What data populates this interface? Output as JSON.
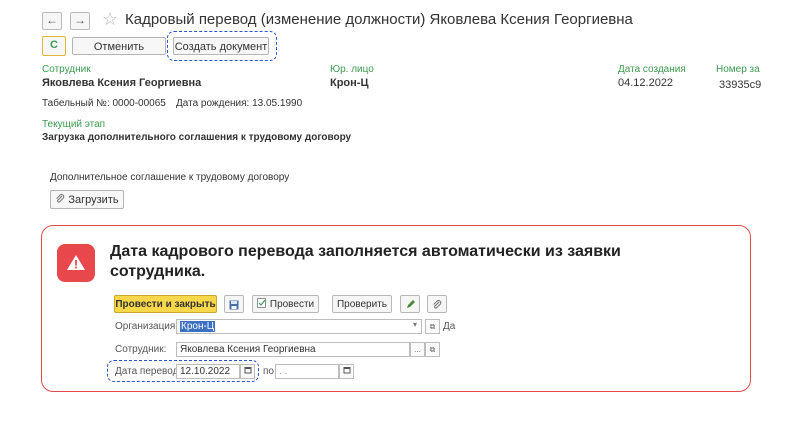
{
  "header": {
    "back_icon": "←",
    "forward_icon": "→",
    "star_icon": "☆",
    "title": "Кадровый перевод (изменение должности) Яковлева Ксения Георгиевна"
  },
  "toolbar": {
    "refresh_icon": "C",
    "cancel_label": "Отменить",
    "create_doc_label": "Создать документ"
  },
  "fields": {
    "employee_label": "Сотрудник",
    "employee_value": "Яковлева Ксения Георгиевна",
    "legal_entity_label": "Юр. лицо",
    "legal_entity_value": "Крон-Ц",
    "created_date_label": "Дата создания",
    "created_date_value": "04.12.2022",
    "number_label": "Номер за",
    "number_value": "33935c9",
    "tab_number_text": "Табельный №:  0000-00065",
    "birth_date_text": "Дата рождения: 13.05.1990",
    "stage_label": "Текущий этап",
    "stage_value": "Загрузка дополнительного соглашения к трудовому договору"
  },
  "attachment": {
    "label": "Дополнительное соглашение к трудовому договору",
    "upload_label": "Загрузить",
    "upload_icon": "paperclip-icon"
  },
  "callout": {
    "icon": "warning-icon",
    "text": "Дата кадрового перевода заполняется автоматически из заявки сотрудника.",
    "accent": "#e8474c"
  },
  "form": {
    "post_close_label": "Провести и закрыть",
    "post_label": "Провести",
    "check_label": "Проверить",
    "org_label": "Организация:",
    "org_value": "Крон-Ц",
    "org_suffix": "Да",
    "employee_label": "Сотрудник:",
    "employee_value": "Яковлева Ксения Георгиевна",
    "transfer_date_label": "Дата перевода:",
    "transfer_date_value": "12.10.2022",
    "to_label": "по:",
    "to_value": ". ."
  },
  "colors": {
    "label_green": "#3c9a4f",
    "dashed_blue": "#2a55c8",
    "callout_border": "#e5484d",
    "primary_button": "#f8d84a"
  }
}
